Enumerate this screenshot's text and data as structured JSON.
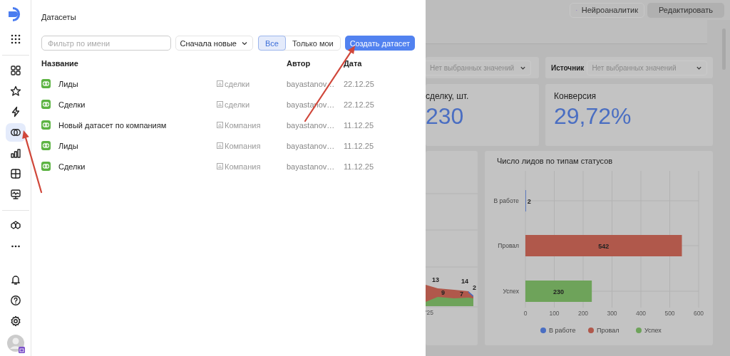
{
  "sidebar": {
    "items": [
      {
        "selected": false
      },
      {
        "selected": false
      },
      {
        "selected": false
      },
      {
        "selected": false
      },
      {
        "selected": true
      },
      {
        "selected": false
      },
      {
        "selected": false
      },
      {
        "selected": false
      },
      {
        "selected": false
      },
      {
        "selected": false
      },
      {
        "selected": false
      },
      {
        "selected": false
      },
      {
        "selected": false
      }
    ]
  },
  "datasets_panel": {
    "title": "Датасеты",
    "filter": {
      "placeholder": "Фильтр по имени"
    },
    "sort": {
      "value": "Сначала новые"
    },
    "scope_tabs": [
      {
        "label": "Все",
        "selected": true
      },
      {
        "label": "Только мои",
        "selected": false
      }
    ],
    "create_button": "Создать датасет",
    "table": {
      "columns": [
        "Название",
        "Автор",
        "Дата"
      ],
      "rows": [
        {
          "name": "Лиды",
          "source": "сделки",
          "author": "bayastanov…",
          "date": "22.12.25"
        },
        {
          "name": "Сделки",
          "source": "сделки",
          "author": "bayastanov…",
          "date": "22.12.25"
        },
        {
          "name": "Новый датасет по компаниям",
          "source": "Компания",
          "author": "bayastanov…",
          "date": "11.12.25"
        },
        {
          "name": "Лиды",
          "source": "Компания",
          "author": "bayastanov…",
          "date": "11.12.25"
        },
        {
          "name": "Сделки",
          "source": "Компания",
          "author": "bayastanov…",
          "date": "11.12.25"
        }
      ]
    }
  },
  "dashboard": {
    "header_buttons": [
      "Нейроаналитик",
      "Редактировать"
    ],
    "filters": [
      {
        "value": "Нет выбранных значений"
      },
      {
        "label": "Источник",
        "value": "Нет выбранных значений"
      }
    ],
    "kpis": [
      {
        "title": "сделку, шт.",
        "value": "230"
      },
      {
        "title": "Конверсия",
        "value": "29,72%"
      }
    ],
    "area_fragment": {
      "labels": [
        "13",
        "14",
        "9",
        "7",
        "2"
      ],
      "axis_label": "'25"
    },
    "status_chart": {
      "chart_data": {
        "type": "bar",
        "orientation": "horizontal",
        "title": "Число лидов по типам статусов",
        "categories": [
          "В работе",
          "Провал",
          "Успех"
        ],
        "series": [
          {
            "name": "В работе",
            "color": "#4a6ec2",
            "values": [
              2,
              null,
              null
            ]
          },
          {
            "name": "Провал",
            "color": "#b0584b",
            "values": [
              null,
              542,
              null
            ]
          },
          {
            "name": "Успех",
            "color": "#6ea35a",
            "values": [
              null,
              null,
              230
            ]
          }
        ],
        "xlim": [
          0,
          600
        ],
        "xticks": [
          0,
          100,
          200,
          300,
          400,
          500,
          600
        ],
        "value_labels": [
          "2",
          "542",
          "230"
        ],
        "grid": true,
        "legend": true
      }
    }
  }
}
